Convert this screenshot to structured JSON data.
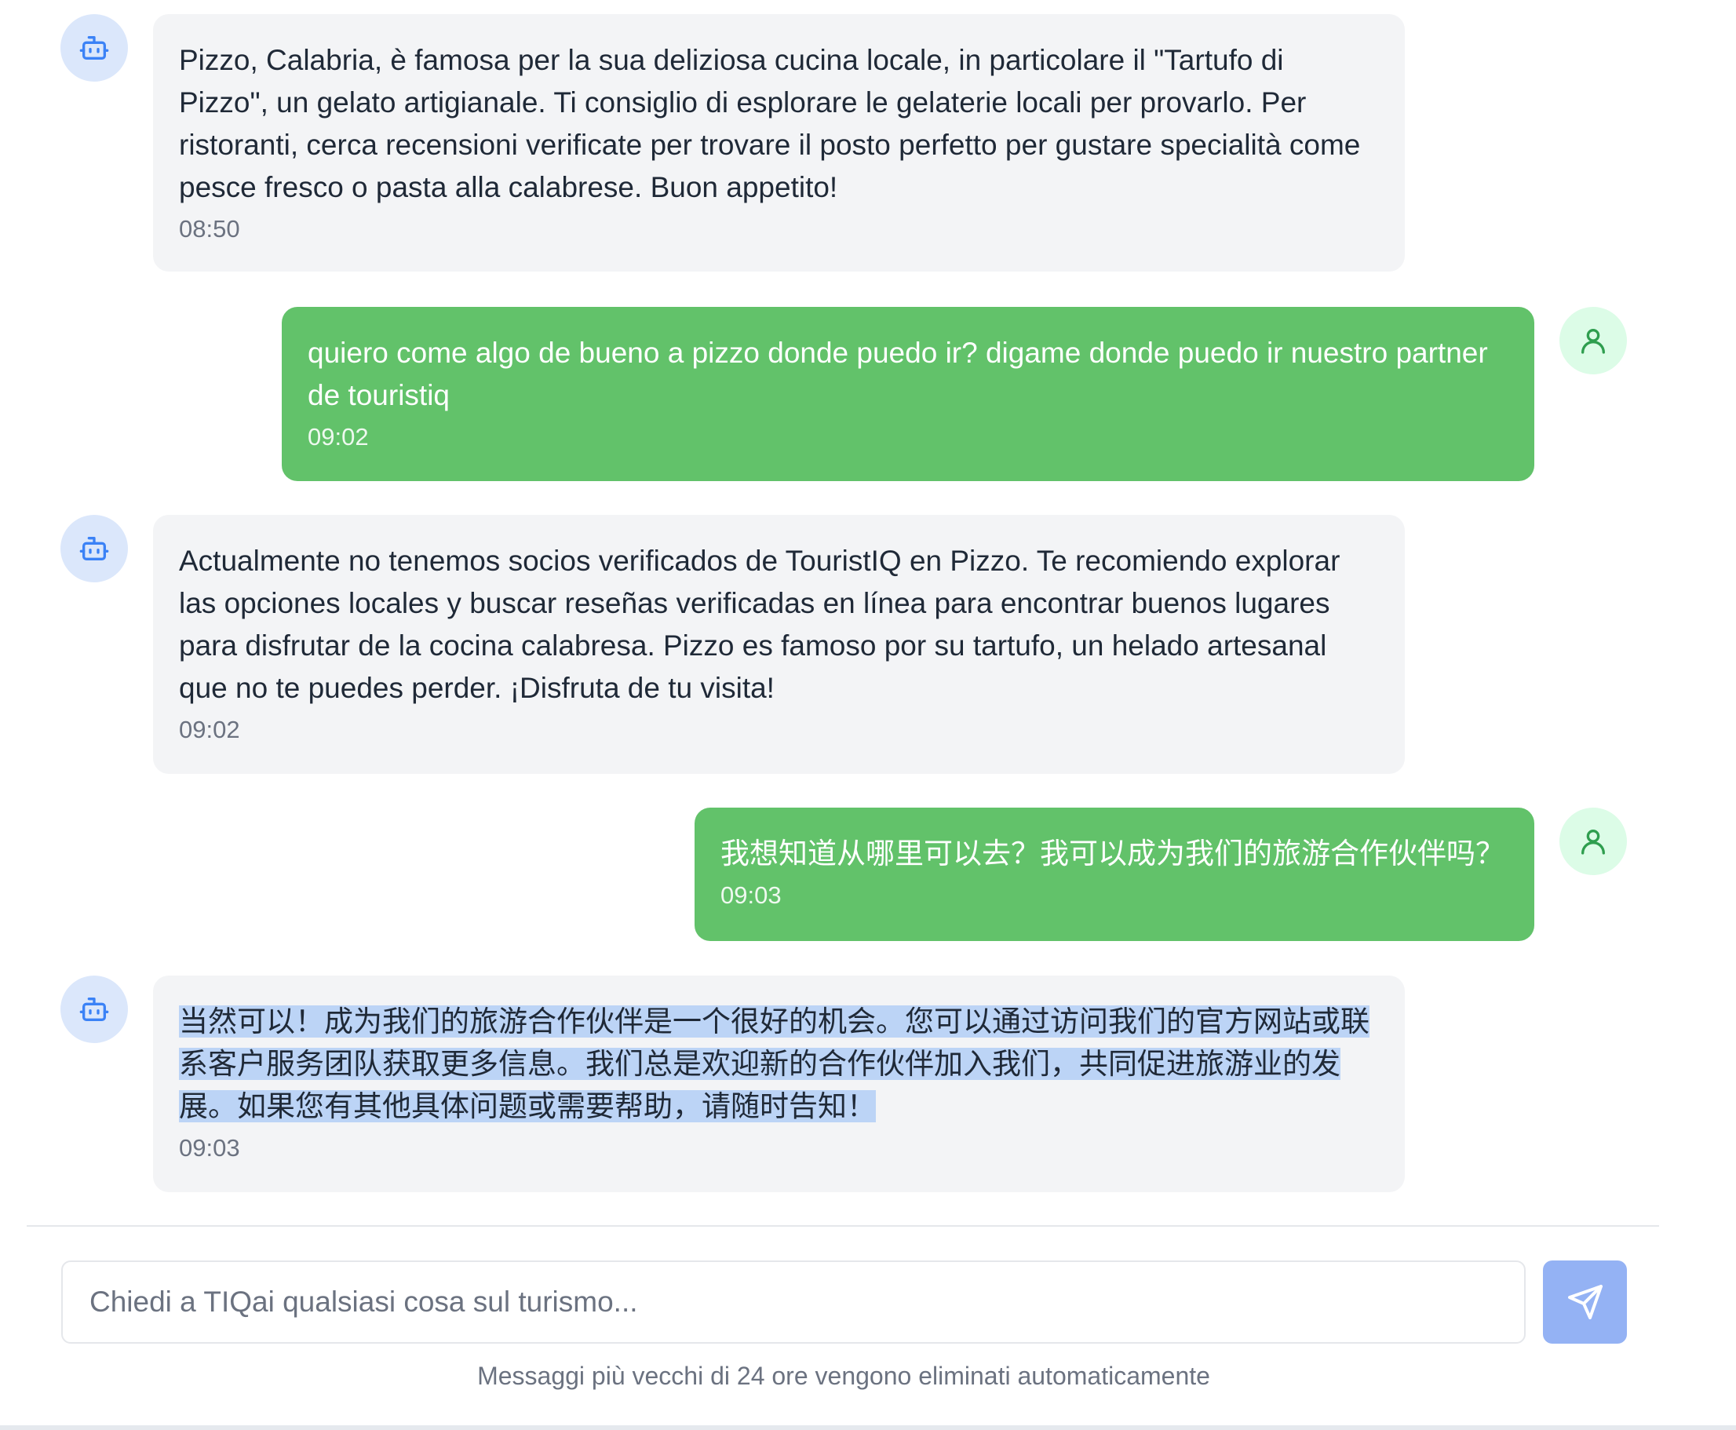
{
  "conversation": {
    "messages": [
      {
        "role": "assistant",
        "text": "Pizzo, Calabria, è famosa per la sua deliziosa cucina locale, in particolare il \"Tartufo di Pizzo\", un gelato artigianale. Ti consiglio di esplorare le gelaterie locali per provarlo. Per ristoranti, cerca recensioni verificate per trovare il posto perfetto per gustare specialità come pesce fresco o pasta alla calabrese. Buon appetito!",
        "time": "08:50",
        "avatar_icon": "bot-icon"
      },
      {
        "role": "user",
        "text": "quiero come algo de bueno a pizzo donde puedo ir? digame donde puedo ir nuestro partner de touristiq",
        "time": "09:02",
        "avatar_icon": "user-icon"
      },
      {
        "role": "assistant",
        "text": "Actualmente no tenemos socios verificados de TouristIQ en Pizzo. Te recomiendo explorar las opciones locales y buscar reseñas verificadas en línea para encontrar buenos lugares para disfrutar de la cocina calabresa. Pizzo es famoso por su tartufo, un helado artesanal que no te puedes perder. ¡Disfruta de tu visita!",
        "time": "09:02",
        "avatar_icon": "bot-icon"
      },
      {
        "role": "user",
        "text": "我想知道从哪里可以去？我可以成为我们的旅游合作伙伴吗？",
        "time": "09:03",
        "avatar_icon": "user-icon"
      },
      {
        "role": "assistant",
        "text": "当然可以！成为我们的旅游合作伙伴是一个很好的机会。您可以通过访问我们的官方网站或联系客户服务团队获取更多信息。我们总是欢迎新的合作伙伴加入我们，共同促进旅游业的发展。如果您有其他具体问题或需要帮助，请随时告知！",
        "time": "09:03",
        "avatar_icon": "bot-icon",
        "selected": true
      }
    ]
  },
  "composer": {
    "placeholder": "Chiedi a TIQai qualsiasi cosa sul turismo...",
    "value": "",
    "send_icon": "send-icon"
  },
  "footer": {
    "note": "Messaggi più vecchi di 24 ore vengono eliminati automaticamente"
  },
  "colors": {
    "user_bubble": "#62c26a",
    "bot_bubble": "#f3f4f6",
    "bot_avatar_bg": "#dbe7fb",
    "user_avatar_bg": "#dcfce7",
    "send_button": "#94b2f4",
    "selection_highlight": "#bcd4f6"
  }
}
